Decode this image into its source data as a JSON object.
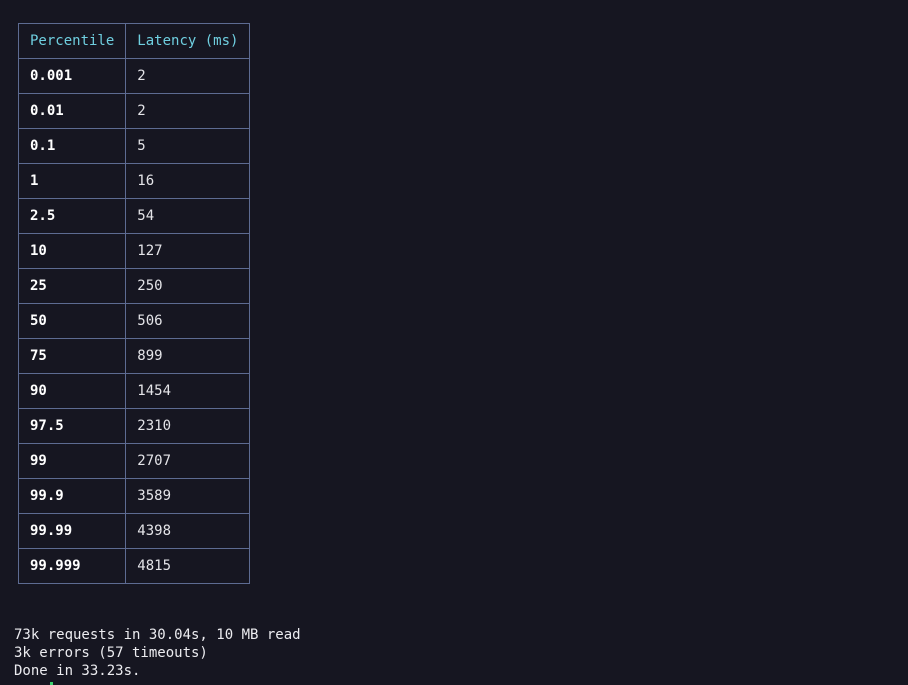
{
  "latency_table": {
    "headers": {
      "percentile": "Percentile",
      "latency": "Latency (ms)"
    },
    "rows": [
      {
        "percentile": "0.001",
        "latency": "2"
      },
      {
        "percentile": "0.01",
        "latency": "2"
      },
      {
        "percentile": "0.1",
        "latency": "5"
      },
      {
        "percentile": "1",
        "latency": "16"
      },
      {
        "percentile": "2.5",
        "latency": "54"
      },
      {
        "percentile": "10",
        "latency": "127"
      },
      {
        "percentile": "25",
        "latency": "250"
      },
      {
        "percentile": "50",
        "latency": "506"
      },
      {
        "percentile": "75",
        "latency": "899"
      },
      {
        "percentile": "90",
        "latency": "1454"
      },
      {
        "percentile": "97.5",
        "latency": "2310"
      },
      {
        "percentile": "99",
        "latency": "2707"
      },
      {
        "percentile": "99.9",
        "latency": "3589"
      },
      {
        "percentile": "99.99",
        "latency": "4398"
      },
      {
        "percentile": "99.999",
        "latency": "4815"
      }
    ]
  },
  "summary": {
    "requests_line": "73k requests in 30.04s, 10 MB read",
    "errors_line": "3k errors (57 timeouts)",
    "done_line": "Done in 33.23s."
  },
  "colors": {
    "background": "#161621",
    "header_text": "#6fcfe0",
    "border": "#5d6b92",
    "cursor": "#3bd16f"
  }
}
